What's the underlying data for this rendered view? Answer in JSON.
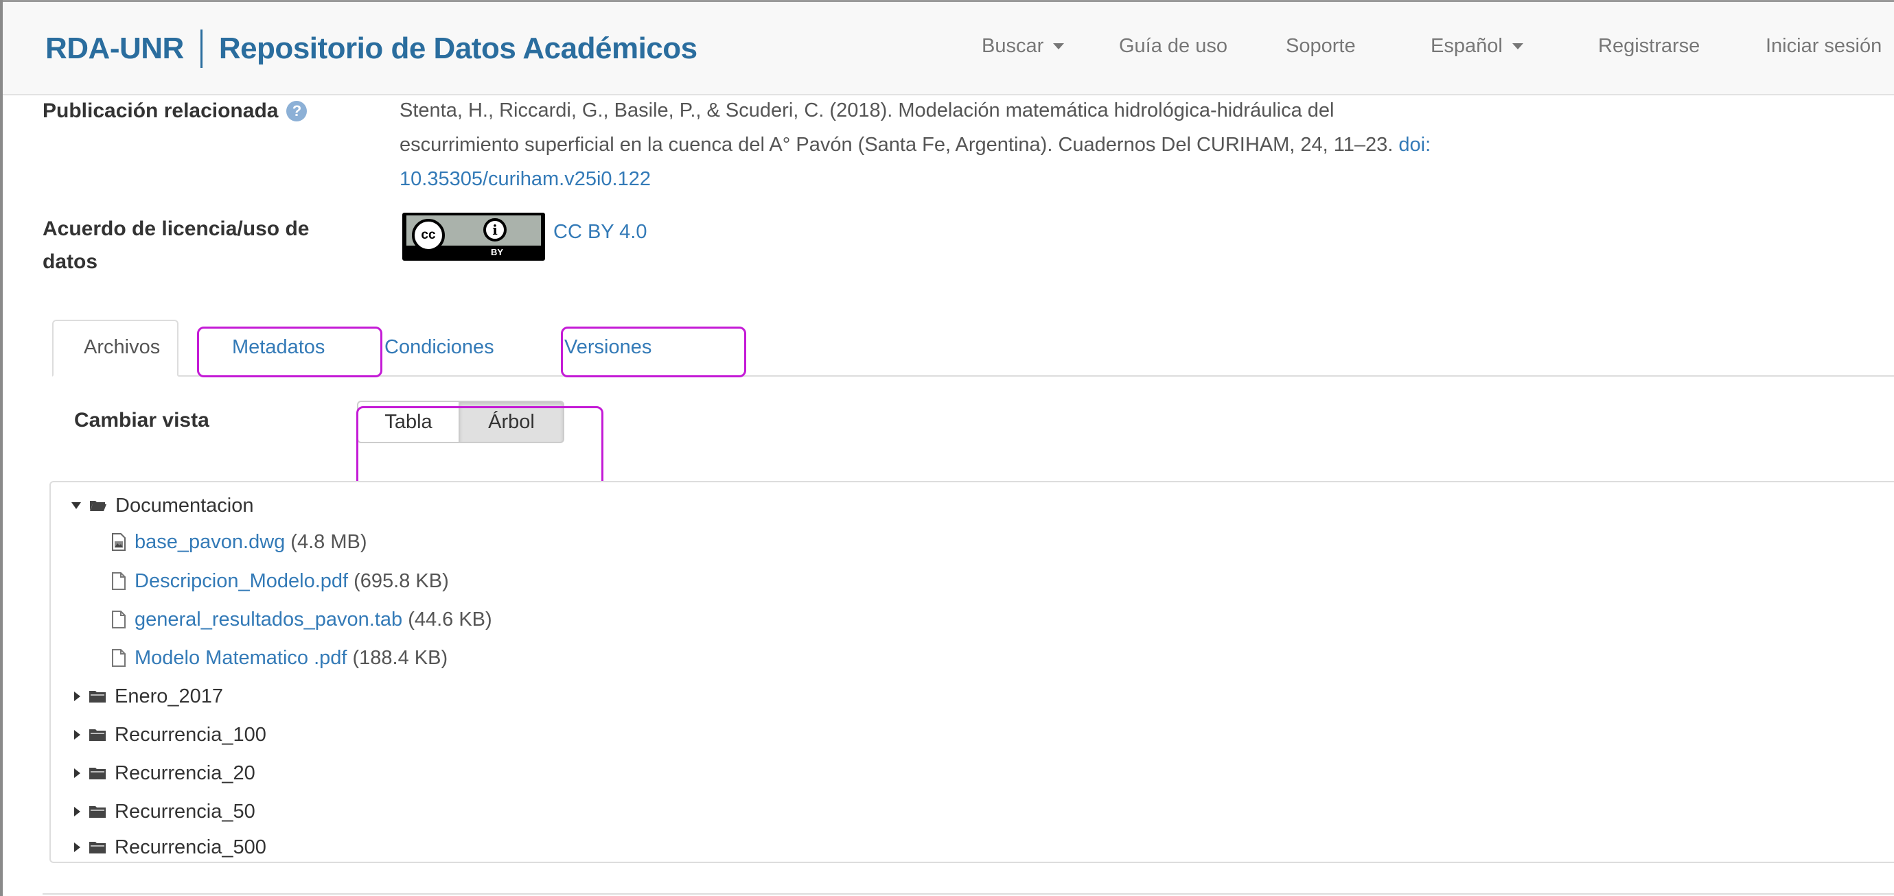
{
  "navbar": {
    "brand_short": "RDA-UNR",
    "brand_long": "Repositorio de Datos Académicos",
    "items": [
      {
        "label": "Buscar",
        "dropdown": true
      },
      {
        "label": "Guía de uso",
        "dropdown": false
      },
      {
        "label": "Soporte",
        "dropdown": false
      },
      {
        "label": "Español",
        "dropdown": true
      },
      {
        "label": "Registrarse",
        "dropdown": false
      },
      {
        "label": "Iniciar sesión",
        "dropdown": false
      }
    ]
  },
  "metadata": {
    "publication_label": "Publicación relacionada",
    "publication_text": "Stenta, H., Riccardi, G., Basile, P., & Scuderi, C. (2018). Modelación matemática hidrológica-hidráulica del escurrimiento superficial en la cuenca del A° Pavón (Santa Fe, Argentina). Cuadernos Del CURIHAM, 24, 11–23. ",
    "doi_link": "doi: 10.35305/curiham.v25i0.122",
    "license_label": "Acuerdo de licencia/uso de datos",
    "license_badge_cc": "cc",
    "license_badge_by_glyph": "i",
    "license_badge_by": "BY",
    "license_link": "CC BY 4.0"
  },
  "tabs": [
    {
      "label": "Archivos",
      "active": true,
      "highlighted": false
    },
    {
      "label": "Metadatos",
      "active": false,
      "highlighted": true
    },
    {
      "label": "Condiciones",
      "active": false,
      "highlighted": false
    },
    {
      "label": "Versiones",
      "active": false,
      "highlighted": true
    }
  ],
  "view_switch": {
    "label": "Cambiar vista",
    "options": [
      "Tabla",
      "Árbol"
    ],
    "selected": "Árbol"
  },
  "tree": {
    "root_open": {
      "name": "Documentacion",
      "expanded": true
    },
    "files": [
      {
        "name": "base_pavon.dwg",
        "size": "(4.8 MB)",
        "icon": "image-file-icon"
      },
      {
        "name": "Descripcion_Modelo.pdf",
        "size": "(695.8 KB)",
        "icon": "file-icon"
      },
      {
        "name": "general_resultados_pavon.tab",
        "size": "(44.6 KB)",
        "icon": "file-icon"
      },
      {
        "name": "Modelo Matematico .pdf",
        "size": "(188.4 KB)",
        "icon": "file-icon"
      }
    ],
    "folders": [
      {
        "name": "Enero_2017",
        "expanded": false
      },
      {
        "name": "Recurrencia_100",
        "expanded": false
      },
      {
        "name": "Recurrencia_20",
        "expanded": false
      },
      {
        "name": "Recurrencia_50",
        "expanded": false
      },
      {
        "name": "Recurrencia_500",
        "expanded": false
      }
    ]
  },
  "colors": {
    "brand": "#2a6d9e",
    "link": "#337ab7",
    "highlight": "#c41bd6"
  }
}
